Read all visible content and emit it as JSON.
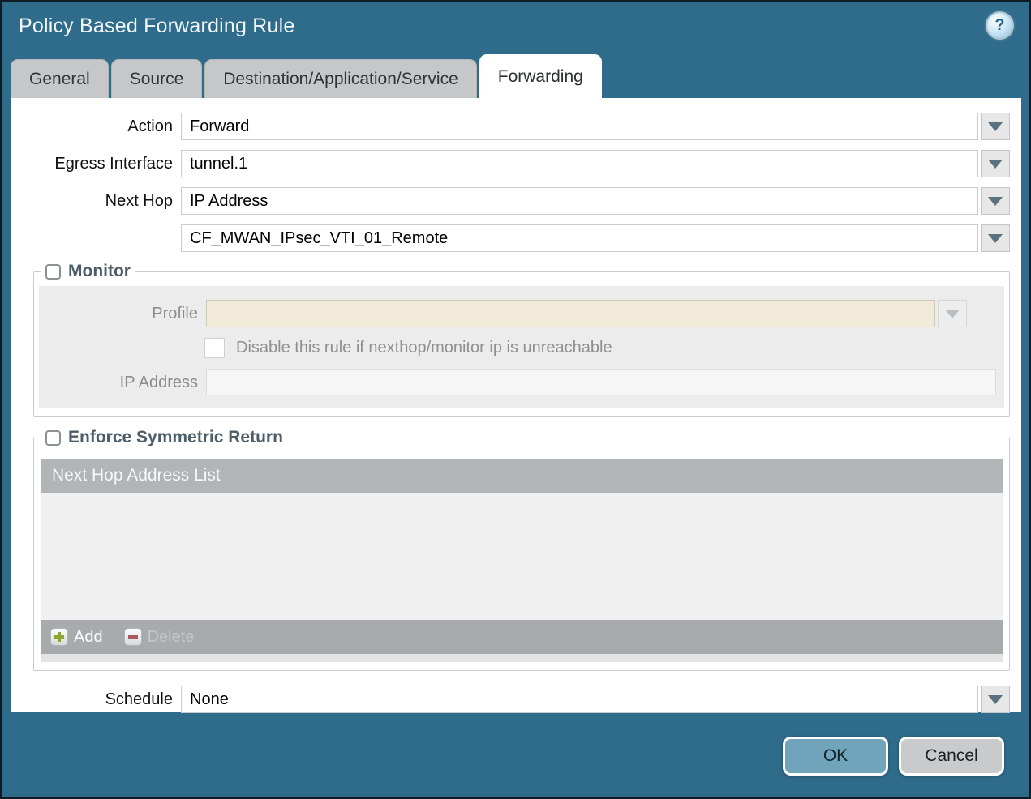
{
  "dialog": {
    "title": "Policy Based Forwarding Rule"
  },
  "icons": {
    "help": "help-icon → ? in glossy circle",
    "chevron": "chevron-down-icon → solid down triangle",
    "add": "add-icon → green plus in rounded square",
    "delete": "delete-icon → red minus in rounded square"
  },
  "tabs": [
    {
      "label": "General",
      "active": false
    },
    {
      "label": "Source",
      "active": false
    },
    {
      "label": "Destination/Application/Service",
      "active": false
    },
    {
      "label": "Forwarding",
      "active": true
    }
  ],
  "form": {
    "action": {
      "label": "Action",
      "value": "Forward"
    },
    "egress_interface": {
      "label": "Egress Interface",
      "value": "tunnel.1"
    },
    "next_hop": {
      "label": "Next Hop",
      "value": "IP Address"
    },
    "next_hop_address": {
      "value": "CF_MWAN_IPsec_VTI_01_Remote"
    },
    "schedule": {
      "label": "Schedule",
      "value": "None"
    }
  },
  "monitor": {
    "label": "Monitor",
    "checked": false,
    "profile": {
      "label": "Profile",
      "value": ""
    },
    "disable_rule": {
      "label": "Disable this rule if nexthop/monitor ip is unreachable",
      "checked": false
    },
    "ip_address": {
      "label": "IP Address",
      "value": ""
    }
  },
  "symmetric_return": {
    "label": "Enforce Symmetric Return",
    "checked": false,
    "table": {
      "header": "Next Hop Address List",
      "rows": []
    },
    "add_label": "Add",
    "delete_label": "Delete"
  },
  "footer": {
    "ok_label": "OK",
    "cancel_label": "Cancel"
  },
  "colors": {
    "titlebar": "#2f6b8a",
    "frame_border": "#0f1c24",
    "tab_inactive": "#c6c7c8",
    "section_label": "#4d5e6a",
    "disabled_field_beige": "#f1ead8",
    "table_header": "#b1b5b8",
    "table_footer": "#a7abae",
    "ok_button": "#6fa4bb",
    "cancel_button": "#c9cacb",
    "add_plus": "#8fa433",
    "delete_minus": "#a85a60"
  }
}
